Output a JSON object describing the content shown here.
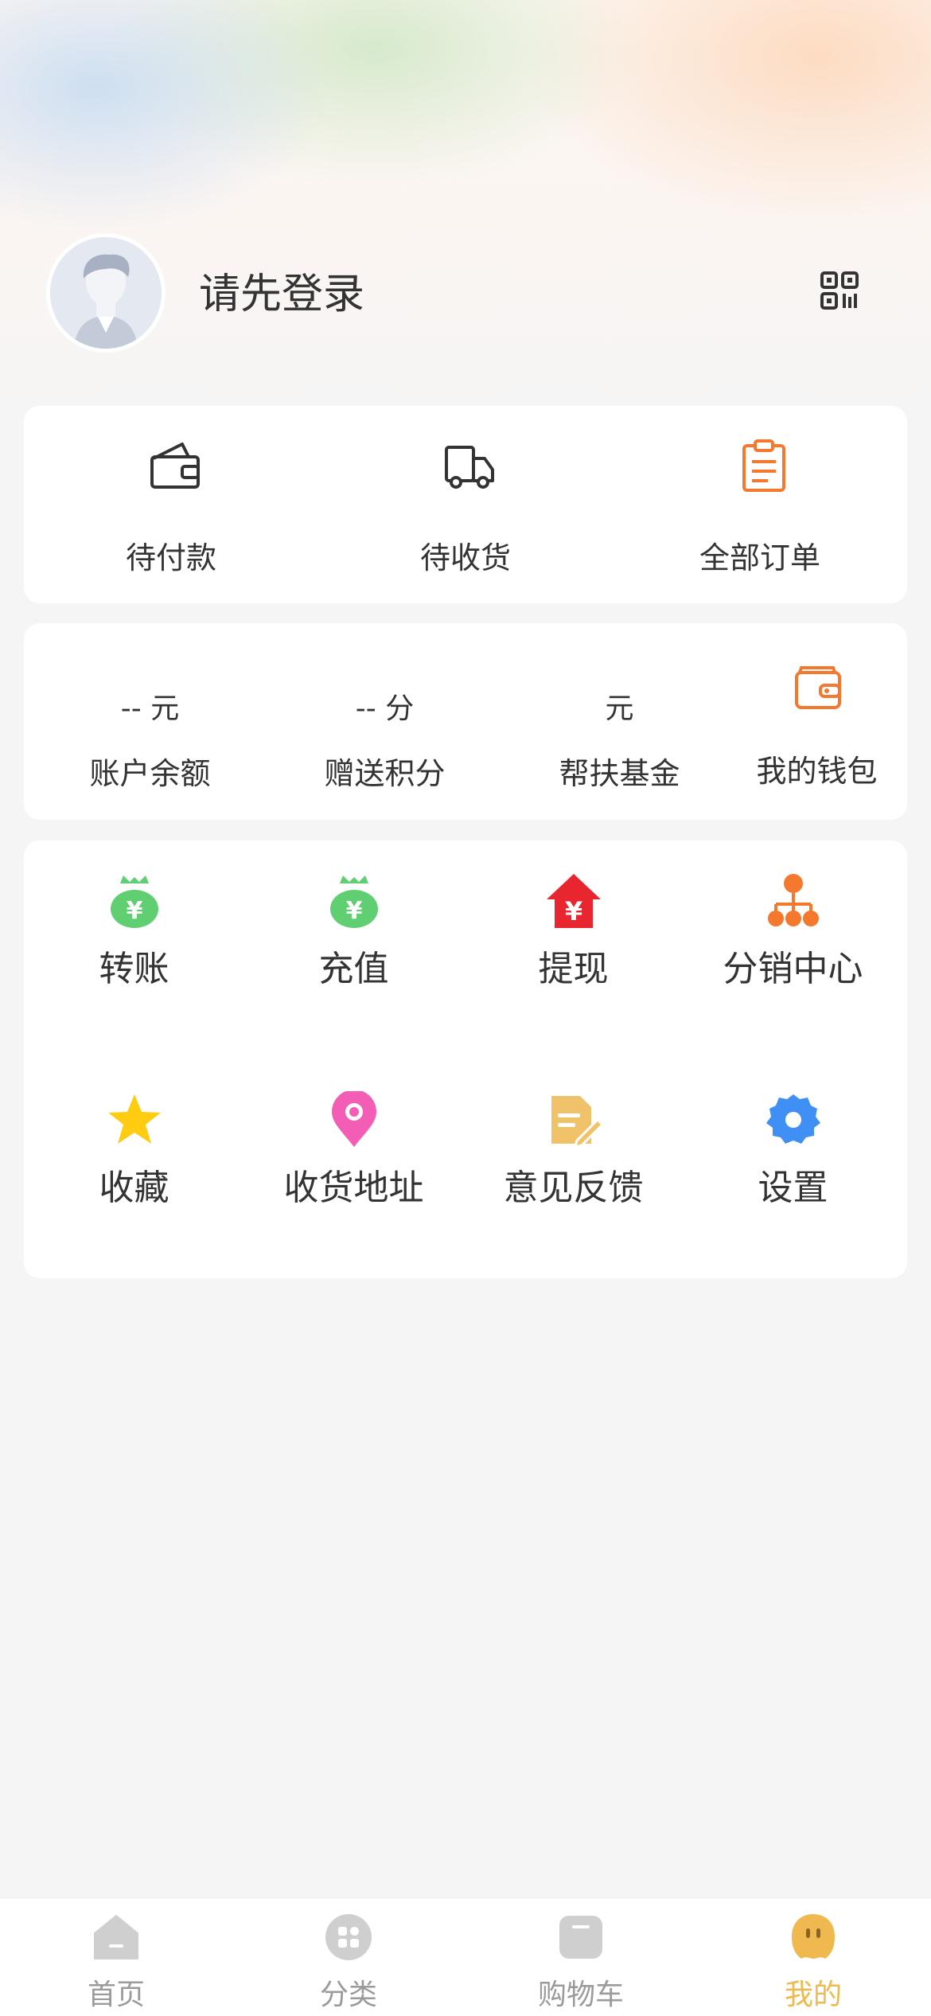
{
  "profile": {
    "login_prompt": "请先登录",
    "avatar_icon": "default-avatar-icon",
    "qr_icon": "qr-code-icon"
  },
  "orders": [
    {
      "label": "待付款",
      "icon": "wallet-icon"
    },
    {
      "label": "待收货",
      "icon": "truck-icon"
    },
    {
      "label": "全部订单",
      "icon": "clipboard-icon"
    }
  ],
  "wallet": {
    "balance": {
      "value": "--",
      "unit": "元",
      "label": "账户余额"
    },
    "points": {
      "value": "--",
      "unit": "分",
      "label": "赠送积分"
    },
    "fund": {
      "value": "",
      "unit": "元",
      "label": "帮扶基金"
    },
    "my_wallet": {
      "label": "我的钱包",
      "icon": "wallet-icon"
    }
  },
  "tools": [
    {
      "label": "转账",
      "icon": "money-bag-icon"
    },
    {
      "label": "充值",
      "icon": "money-bag-icon"
    },
    {
      "label": "提现",
      "icon": "house-yen-icon"
    },
    {
      "label": "分销中心",
      "icon": "hierarchy-icon"
    },
    {
      "label": "收藏",
      "icon": "star-icon"
    },
    {
      "label": "收货地址",
      "icon": "location-pin-icon"
    },
    {
      "label": "意见反馈",
      "icon": "document-edit-icon"
    },
    {
      "label": "设置",
      "icon": "gear-icon"
    }
  ],
  "tabbar": [
    {
      "label": "首页",
      "icon": "home-icon"
    },
    {
      "label": "分类",
      "icon": "category-icon"
    },
    {
      "label": "购物车",
      "icon": "cart-icon"
    },
    {
      "label": "我的",
      "icon": "profile-icon",
      "active": true
    }
  ],
  "colors": {
    "accent": "#f0b94f",
    "orange": "#f5782f",
    "green": "#5fcf72",
    "red": "#e8262f",
    "pink": "#f45db5",
    "blue": "#3f8ff5",
    "yellow": "#ffcc11"
  }
}
